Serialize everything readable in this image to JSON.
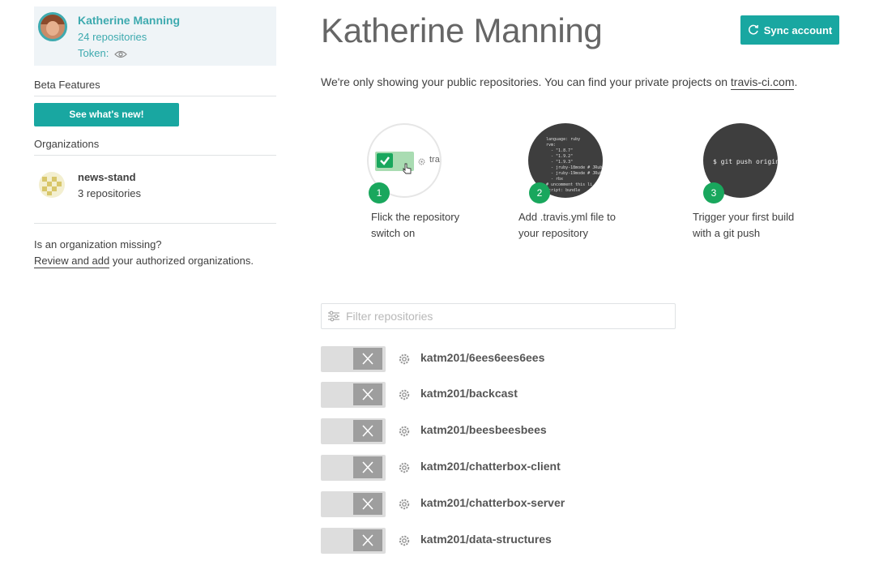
{
  "profile": {
    "name": "Katherine Manning",
    "repos": "24 repositories",
    "token_label": "Token:"
  },
  "sidebar": {
    "beta_title": "Beta Features",
    "beta_button": "See what's new!",
    "org_title": "Organizations",
    "orgs": [
      {
        "name": "news-stand",
        "repos": "3 repositories"
      }
    ],
    "missing_question": "Is an organization missing?",
    "missing_link": "Review and add",
    "missing_rest": " your authorized organizations."
  },
  "main": {
    "title": "Katherine Manning",
    "sync_button": "Sync account",
    "notice_text": "We're only showing your public repositories. You can find your private projects on ",
    "notice_link": "travis-ci.com",
    "notice_end": ".",
    "steps": [
      {
        "number": "1",
        "text": "Flick the repository switch on",
        "preview": "tra"
      },
      {
        "number": "2",
        "text": "Add .travis.yml file to your repository",
        "preview": "language: ruby\nrvm:\n  - \"1.8.7\"\n  - \"1.9.2\"\n  - \"1.9.3\"\n  - jruby-18mode # JRuby\n  - jruby-19mode # JRuby\n  - rbx\n# uncomment this li\nscript: bundle"
      },
      {
        "number": "3",
        "text": "Trigger your first build with a git push",
        "preview": "$ git push origin"
      }
    ],
    "filter_placeholder": "Filter repositories",
    "repos": [
      "katm201/6ees6ees6ees",
      "katm201/backcast",
      "katm201/beesbeesbees",
      "katm201/chatterbox-client",
      "katm201/chatterbox-server",
      "katm201/data-structures"
    ]
  },
  "colors": {
    "accent": "#19a7a1",
    "link": "#3eaaaf",
    "step_badge": "#19a75d"
  },
  "icons": [
    "eye-icon",
    "sync-icon",
    "filter-icon",
    "gear-icon",
    "close-icon",
    "checkmark-icon"
  ]
}
